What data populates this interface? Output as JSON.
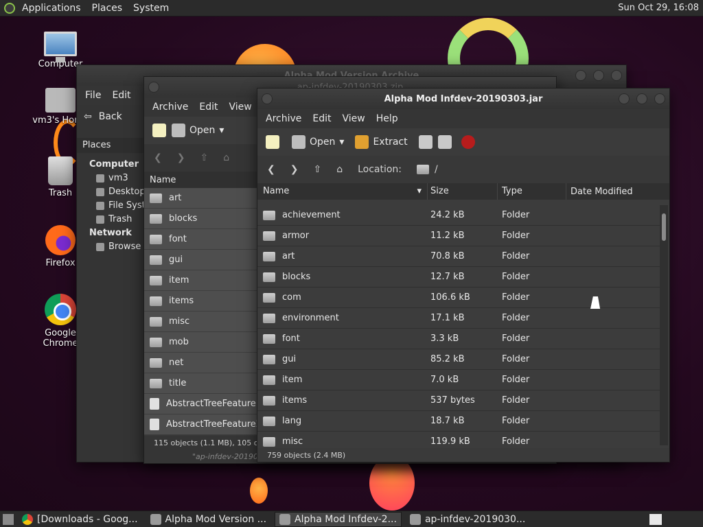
{
  "top_panel": {
    "menus": [
      "Applications",
      "Places",
      "System"
    ],
    "clock": "Sun Oct 29, 16:08"
  },
  "desktop_icons": [
    {
      "label": "Computer",
      "icon": "monitor-icon"
    },
    {
      "label": "vm3's Home",
      "icon": "home-folder-icon"
    },
    {
      "label": "Trash",
      "icon": "trash-icon"
    },
    {
      "label": "Firefox",
      "icon": "firefox-icon"
    },
    {
      "label": "Google Chrome",
      "icon": "chrome-icon"
    }
  ],
  "back_window": {
    "title": "Alpha Mod Version Archive",
    "menus": [
      "File",
      "Edit"
    ],
    "back_label": "Back",
    "places_label": "Places",
    "sidebar": {
      "computer_header": "Computer",
      "computer_items": [
        "vm3",
        "Desktop",
        "File System",
        "Trash"
      ],
      "network_header": "Network",
      "network_items": [
        "Browse Network"
      ]
    }
  },
  "mid_window": {
    "title": "ap-infdev-20190303.zip",
    "menus": [
      "Archive",
      "Edit",
      "View"
    ],
    "open_label": "Open",
    "column_name": "Name",
    "folders": [
      "art",
      "blocks",
      "font",
      "gui",
      "item",
      "items",
      "misc",
      "mob",
      "net",
      "title"
    ],
    "files": [
      "AbstractTreeFeature.class",
      "AbstractTreeFeature2.class"
    ],
    "status": "115 objects (1.1 MB), 105 objects selected",
    "footer": "\"ap-infdev-20190303.zip\""
  },
  "front_window": {
    "title": "Alpha Mod Infdev-20190303.jar",
    "menus": [
      "Archive",
      "Edit",
      "View",
      "Help"
    ],
    "open_label": "Open",
    "extract_label": "Extract",
    "location_label": "Location:",
    "location_value": "/",
    "columns": {
      "name": "Name",
      "size": "Size",
      "type": "Type",
      "date": "Date Modified"
    },
    "rows": [
      {
        "name": "achievement",
        "size": "24.2 kB",
        "type": "Folder"
      },
      {
        "name": "armor",
        "size": "11.2 kB",
        "type": "Folder"
      },
      {
        "name": "art",
        "size": "70.8 kB",
        "type": "Folder"
      },
      {
        "name": "blocks",
        "size": "12.7 kB",
        "type": "Folder"
      },
      {
        "name": "com",
        "size": "106.6 kB",
        "type": "Folder"
      },
      {
        "name": "environment",
        "size": "17.1 kB",
        "type": "Folder"
      },
      {
        "name": "font",
        "size": "3.3 kB",
        "type": "Folder"
      },
      {
        "name": "gui",
        "size": "85.2 kB",
        "type": "Folder"
      },
      {
        "name": "item",
        "size": "7.0 kB",
        "type": "Folder"
      },
      {
        "name": "items",
        "size": "537 bytes",
        "type": "Folder"
      },
      {
        "name": "lang",
        "size": "18.7 kB",
        "type": "Folder"
      },
      {
        "name": "misc",
        "size": "119.9 kB",
        "type": "Folder"
      }
    ],
    "status": "759 objects (2.4 MB)"
  },
  "taskbar": {
    "tasks": [
      {
        "label": "[Downloads - Goog...",
        "icon": "chrome-icon",
        "active": false
      },
      {
        "label": "Alpha Mod Version ...",
        "icon": "folder-icon",
        "active": false
      },
      {
        "label": "Alpha Mod Infdev-2...",
        "icon": "archive-icon",
        "active": true
      },
      {
        "label": "ap-infdev-2019030...",
        "icon": "archive-icon",
        "active": false
      }
    ]
  }
}
